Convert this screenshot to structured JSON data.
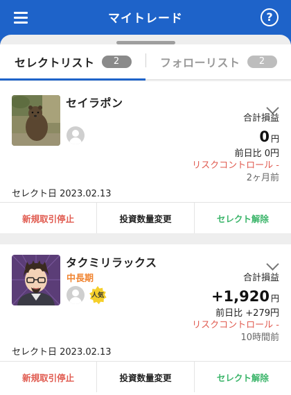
{
  "header": {
    "title": "マイトレード",
    "help_label": "?"
  },
  "tabs": [
    {
      "label": "セレクトリスト",
      "count": "2",
      "active": true
    },
    {
      "label": "フォローリスト",
      "count": "2",
      "active": false
    }
  ],
  "cards": [
    {
      "name": "セイラポン",
      "tag": "",
      "pl_label": "合計損益",
      "pl_value": "0",
      "pl_unit": "円",
      "diff": "前日比 0円",
      "risk": "リスクコントロール -",
      "ago": "2ヶ月前",
      "select_date": "セレクト日 2023.02.13",
      "actions": {
        "stop": "新規取引停止",
        "qty": "投資数量変更",
        "release": "セレクト解除"
      }
    },
    {
      "name": "タクミリラックス",
      "tag": "中長期",
      "badge": "人気",
      "pl_label": "合計損益",
      "pl_value": "+1,920",
      "pl_unit": "円",
      "diff": "前日比 +279円",
      "risk": "リスクコントロール -",
      "ago": "10時間前",
      "select_date": "セレクト日 2023.02.13",
      "actions": {
        "stop": "新規取引停止",
        "qty": "投資数量変更",
        "release": "セレクト解除"
      }
    }
  ],
  "colors": {
    "brand": "#1e63c9",
    "risk": "#e05a4f",
    "release": "#3bb56a",
    "tag": "#f0832f"
  }
}
